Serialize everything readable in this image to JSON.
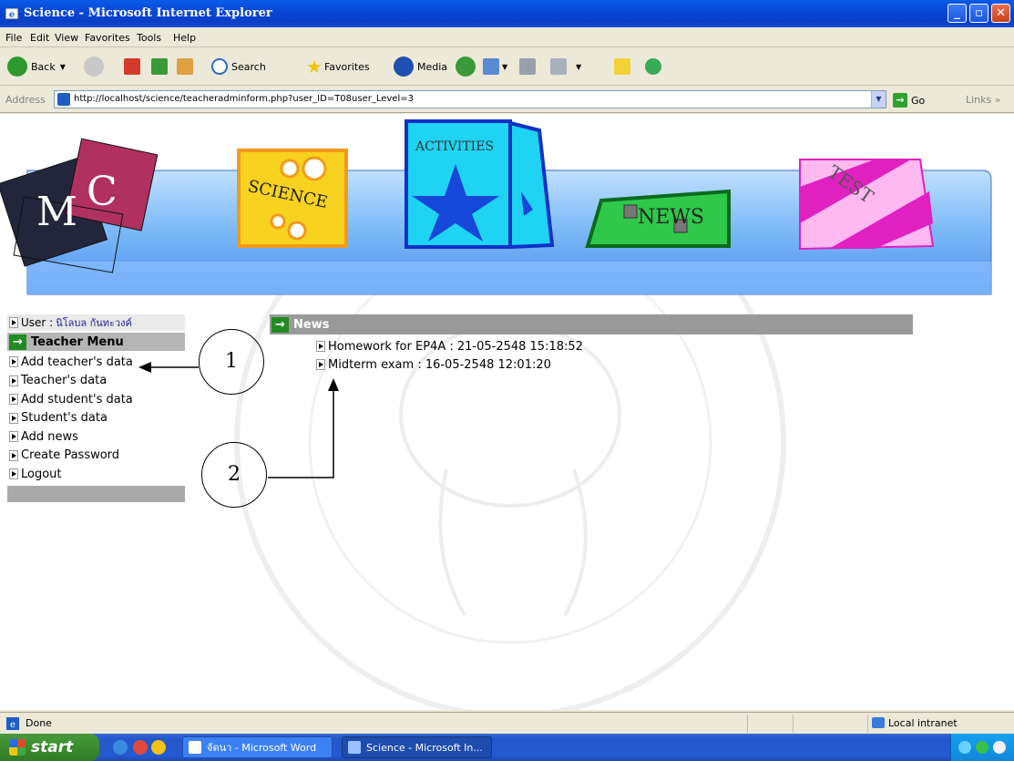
{
  "window": {
    "title": "Science - Microsoft Internet Explorer",
    "buttons": {
      "minimize": "_",
      "maximize": "▫",
      "close": "✕"
    }
  },
  "menu": [
    "File",
    "Edit",
    "View",
    "Favorites",
    "Tools",
    "Help"
  ],
  "toolbar": {
    "back_label": "Back",
    "search_label": "Search",
    "favorites_label": "Favorites",
    "media_label": "Media"
  },
  "address": {
    "label": "Address",
    "url": "http://localhost/science/teacheradminform.php?user_ID=T08user_Level=3",
    "go_label": "Go",
    "links_label": "Links"
  },
  "banner": {
    "logo_text": "MC",
    "tiles": [
      "SCIENCE",
      "ACTIVITIES",
      "NEWS",
      "TEST"
    ]
  },
  "sidebar": {
    "user_label": "User :",
    "user_name": "นิโลบล กันทะวงค์",
    "menu_title": "Teacher Menu",
    "items": [
      "Add teacher's data",
      "Teacher's data",
      "Add student's data",
      "Student's data",
      "Add news",
      "Create Password",
      "Logout"
    ]
  },
  "news": {
    "title": "News",
    "items": [
      "Homework for EP4A : 21-05-2548 15:18:52",
      "Midterm exam : 16-05-2548 12:01:20"
    ]
  },
  "callouts": [
    "1",
    "2"
  ],
  "status": {
    "text": "Done",
    "zone": "Local intranet"
  },
  "taskbar": {
    "start_label": "start",
    "tasks": [
      "จัดนา - Microsoft Word",
      "Science - Microsoft In..."
    ]
  },
  "colors": {
    "titlebar": "#0a5be8",
    "news_header": "#9a9a9a",
    "menu_header": "#b5b5b5",
    "arrow_green": "#228b22",
    "banner_blue": "#5aa9f5"
  }
}
